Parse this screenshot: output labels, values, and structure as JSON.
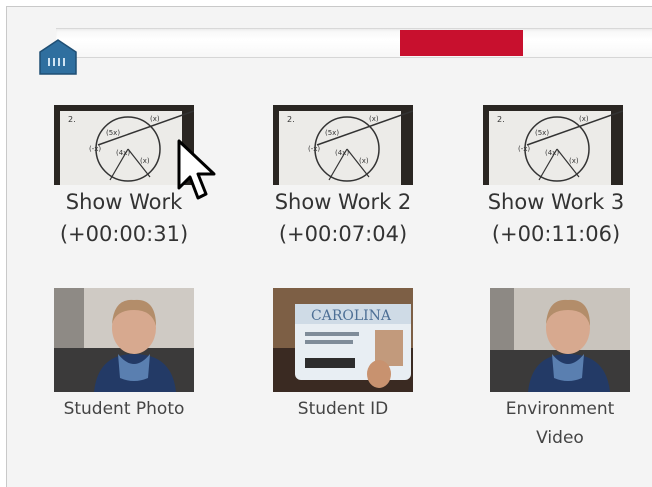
{
  "timeline": {
    "marker_color": "#c8102e",
    "playhead_icon": "playhead-house-icon"
  },
  "work_items": [
    {
      "title": "Show Work",
      "timestamp": "(+00:00:31)"
    },
    {
      "title": "Show Work 2",
      "timestamp": "(+00:07:04)"
    },
    {
      "title": "Show Work 3",
      "timestamp": "(+00:11:06)"
    }
  ],
  "media_items": [
    {
      "label": "Student Photo",
      "label_line2": ""
    },
    {
      "label": "Student ID",
      "label_line2": ""
    },
    {
      "label": "Environment",
      "label_line2": "Video"
    }
  ],
  "id_card": {
    "brand": "CAROLINA"
  },
  "paper_marks": {
    "number": "2."
  }
}
